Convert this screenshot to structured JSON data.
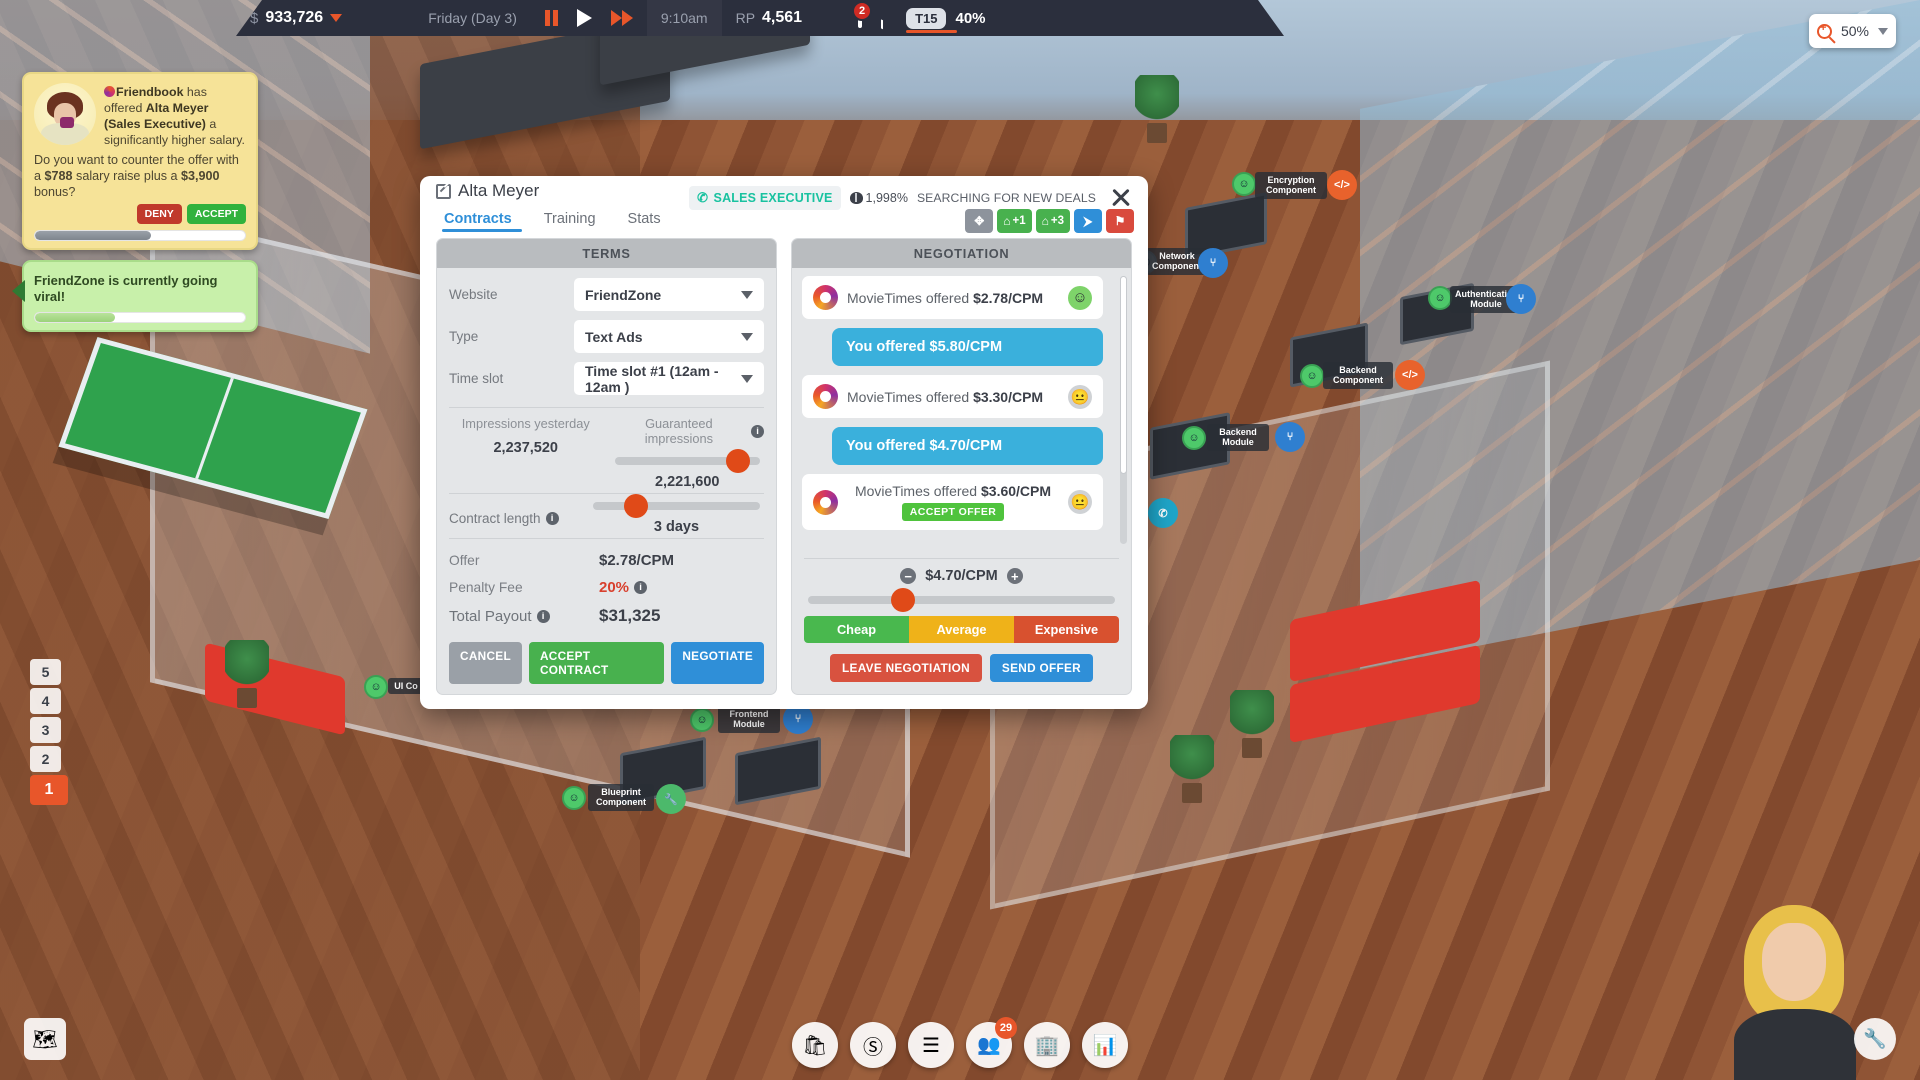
{
  "topbar": {
    "currency_symbol": "$",
    "money": "933,726",
    "day": "Friday (Day 3)",
    "time": "9:10am",
    "rp_label": "RP",
    "rp_value": "4,561",
    "mail_count": "2",
    "tech_pill": "T15",
    "tech_pct": "40%"
  },
  "zoom_control": {
    "level": "50%"
  },
  "notifications": [
    {
      "type": "offer",
      "source": "Friendbook",
      "text_line": " has offered ",
      "person": "Alta Meyer",
      "role": "(Sales Executive)",
      "text_tail": " a significantly higher salary.",
      "question_pre": "Do you want to counter the offer with a ",
      "raise": "$788",
      "question_mid": " salary raise plus a ",
      "bonus": "$3,900",
      "question_end": " bonus?",
      "deny_label": "DENY",
      "accept_label": "ACCEPT",
      "progress_pct": 55
    },
    {
      "type": "viral",
      "message": "FriendZone is currently going viral!",
      "progress_pct": 38
    }
  ],
  "levels": {
    "items": [
      "5",
      "4",
      "3",
      "2",
      "1"
    ],
    "active": "1"
  },
  "dialog": {
    "title": "Alta Meyer",
    "role_badge": "SALES EXECUTIVE",
    "skill_pct": "1,998%",
    "status": "SEARCHING FOR NEW DEALS",
    "tabs": [
      {
        "label": "Contracts",
        "active": true
      },
      {
        "label": "Training",
        "active": false
      },
      {
        "label": "Stats",
        "active": false
      }
    ],
    "header_actions": [
      {
        "name": "move",
        "label": "",
        "color": "grey",
        "glyph": "✥"
      },
      {
        "name": "promote-1",
        "label": "+1",
        "color": "green",
        "glyph": "⌂"
      },
      {
        "name": "promote-3",
        "label": "+3",
        "color": "green",
        "glyph": "⌂"
      },
      {
        "name": "assign",
        "label": "",
        "color": "blue",
        "glyph": "⮞"
      },
      {
        "name": "fire",
        "label": "",
        "color": "red",
        "glyph": "⚑"
      }
    ],
    "terms": {
      "header": "TERMS",
      "website_label": "Website",
      "website_value": "FriendZone",
      "type_label": "Type",
      "type_value": "Text Ads",
      "timeslot_label": "Time slot",
      "timeslot_value": "Time slot #1 (12am - 12am )",
      "impressions_yesterday_label": "Impressions yesterday",
      "impressions_yesterday_value": "2,237,520",
      "guaranteed_label": "Guaranteed impressions",
      "guaranteed_value": "2,221,600",
      "guaranteed_slider_pct": 85,
      "contract_length_label": "Contract length",
      "contract_length_value": "3 days",
      "contract_slider_pct": 26,
      "offer_label": "Offer",
      "offer_value": "$2.78/CPM",
      "penalty_label": "Penalty Fee",
      "penalty_value": "20%",
      "total_payout_label": "Total Payout",
      "total_payout_value": "$31,325",
      "buttons": {
        "cancel": "CANCEL",
        "accept": "ACCEPT CONTRACT",
        "negotiate": "NEGOTIATE"
      }
    },
    "negotiation": {
      "header": "NEGOTIATION",
      "messages": [
        {
          "side": "them",
          "party": "MovieTimes",
          "text_pre": "MovieTimes offered ",
          "amount": "$2.78/CPM",
          "mood": "happy",
          "accept_offer": null
        },
        {
          "side": "you",
          "text": "You offered $5.80/CPM"
        },
        {
          "side": "them",
          "party": "MovieTimes",
          "text_pre": "MovieTimes offered ",
          "amount": "$3.30/CPM",
          "mood": "neutral",
          "accept_offer": null
        },
        {
          "side": "you",
          "text": "You offered $4.70/CPM"
        },
        {
          "side": "them",
          "party": "MovieTimes",
          "text_pre": "MovieTimes offered ",
          "amount": "$3.60/CPM",
          "mood": "neutral",
          "accept_offer": "ACCEPT OFFER"
        }
      ],
      "current_cpm": "$4.70/CPM",
      "cpm_slider_pct": 31,
      "price_bar": [
        {
          "label": "Cheap",
          "color": "#49b84e"
        },
        {
          "label": "Average",
          "color": "#efb219"
        },
        {
          "label": "Expensive",
          "color": "#d8512f"
        }
      ],
      "buttons": {
        "leave": "LEAVE NEGOTIATION",
        "send": "SEND OFFER"
      }
    }
  },
  "world_tags": [
    {
      "label": "Encryption Component"
    },
    {
      "label": "Network Component"
    },
    {
      "label": "Authentication Module"
    },
    {
      "label": "Backend Component"
    },
    {
      "label": "Backend Module"
    },
    {
      "label": "Frontend Module"
    },
    {
      "label": "Blueprint Component"
    },
    {
      "label": "UI Co"
    }
  ],
  "dock": {
    "buttons": [
      {
        "name": "shop",
        "glyph": "🛍"
      },
      {
        "name": "finance",
        "glyph": "Ⓢ"
      },
      {
        "name": "products",
        "glyph": "☰"
      },
      {
        "name": "staff",
        "glyph": "👥",
        "badge": "29"
      },
      {
        "name": "building",
        "glyph": "🏢"
      },
      {
        "name": "stats",
        "glyph": "📊"
      }
    ]
  },
  "map_button": {
    "glyph": "🗺"
  },
  "wrench_button": {
    "glyph": "🔧"
  }
}
